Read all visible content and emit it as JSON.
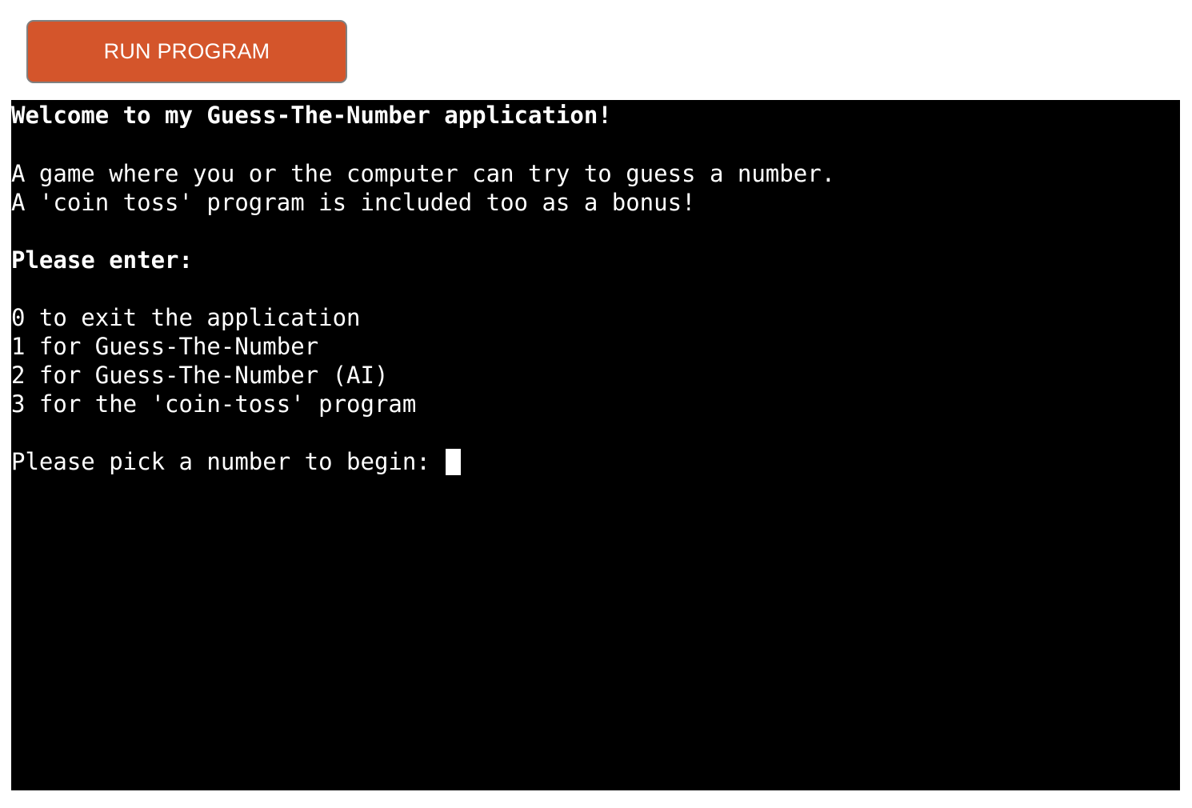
{
  "window": {
    "background_color": "#ffffff"
  },
  "toolbar": {
    "run_button_label": "RUN PROGRAM",
    "run_button_bg": "#d4552b",
    "run_button_border": "#808080",
    "run_button_text_color": "#ffffff"
  },
  "terminal": {
    "background_color": "#000000",
    "text_color": "#ffffff",
    "lines": [
      {
        "text": "Welcome to my Guess-The-Number application!",
        "bold": true
      },
      {
        "text": "",
        "bold": false
      },
      {
        "text": "A game where you or the computer can try to guess a number.",
        "bold": false
      },
      {
        "text": "A 'coin toss' program is included too as a bonus!",
        "bold": false
      },
      {
        "text": "",
        "bold": false
      },
      {
        "text": "Please enter:",
        "bold": true
      },
      {
        "text": "",
        "bold": false
      },
      {
        "text": "0 to exit the application",
        "bold": false
      },
      {
        "text": "1 for Guess-The-Number",
        "bold": false
      },
      {
        "text": "2 for Guess-The-Number (AI)",
        "bold": false
      },
      {
        "text": "3 for the 'coin-toss' program",
        "bold": false
      },
      {
        "text": "",
        "bold": false
      }
    ],
    "prompt": {
      "text": "Please pick a number to begin: ",
      "cursor": "block-cursor"
    }
  }
}
